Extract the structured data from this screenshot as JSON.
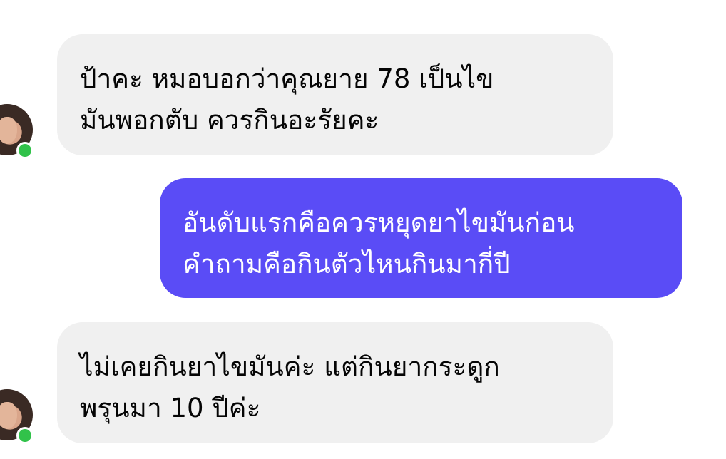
{
  "messages": [
    {
      "direction": "incoming",
      "lines": [
        "ป้าคะ หมอบอกว่าคุณยาย 78 เป็นไข",
        "มันพอกตับ ควรกินอะรัยคะ"
      ]
    },
    {
      "direction": "outgoing",
      "lines": [
        "อันดับแรกคือควรหยุดยาไขมันก่อน",
        "คำถามคือกินตัวไหนกินมากี่ปี"
      ]
    },
    {
      "direction": "incoming",
      "lines": [
        "ไม่เคยกินยาไขมันค่ะ  แต่กินยากระดูก",
        "พรุนมา 10 ปีค่ะ"
      ]
    }
  ],
  "colors": {
    "incoming_bubble": "#f0f0f0",
    "outgoing_bubble": "#5a4cf6",
    "online_indicator": "#31c24a"
  },
  "icons": {
    "avatar": "profile-photo",
    "online": "online-status-dot"
  }
}
